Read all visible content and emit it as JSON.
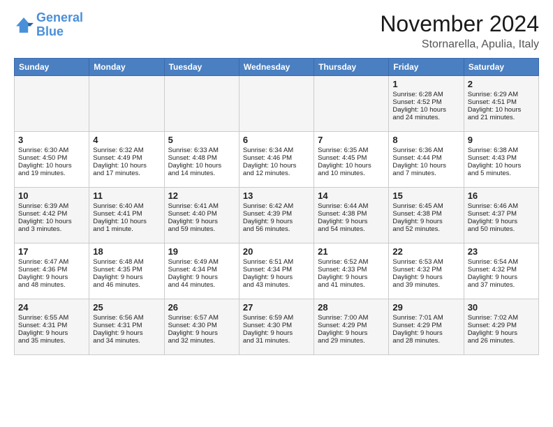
{
  "header": {
    "logo_line1": "General",
    "logo_line2": "Blue",
    "title": "November 2024",
    "subtitle": "Stornarella, Apulia, Italy"
  },
  "weekdays": [
    "Sunday",
    "Monday",
    "Tuesday",
    "Wednesday",
    "Thursday",
    "Friday",
    "Saturday"
  ],
  "weeks": [
    [
      {
        "day": "",
        "info": ""
      },
      {
        "day": "",
        "info": ""
      },
      {
        "day": "",
        "info": ""
      },
      {
        "day": "",
        "info": ""
      },
      {
        "day": "",
        "info": ""
      },
      {
        "day": "1",
        "info": "Sunrise: 6:28 AM\nSunset: 4:52 PM\nDaylight: 10 hours\nand 24 minutes."
      },
      {
        "day": "2",
        "info": "Sunrise: 6:29 AM\nSunset: 4:51 PM\nDaylight: 10 hours\nand 21 minutes."
      }
    ],
    [
      {
        "day": "3",
        "info": "Sunrise: 6:30 AM\nSunset: 4:50 PM\nDaylight: 10 hours\nand 19 minutes."
      },
      {
        "day": "4",
        "info": "Sunrise: 6:32 AM\nSunset: 4:49 PM\nDaylight: 10 hours\nand 17 minutes."
      },
      {
        "day": "5",
        "info": "Sunrise: 6:33 AM\nSunset: 4:48 PM\nDaylight: 10 hours\nand 14 minutes."
      },
      {
        "day": "6",
        "info": "Sunrise: 6:34 AM\nSunset: 4:46 PM\nDaylight: 10 hours\nand 12 minutes."
      },
      {
        "day": "7",
        "info": "Sunrise: 6:35 AM\nSunset: 4:45 PM\nDaylight: 10 hours\nand 10 minutes."
      },
      {
        "day": "8",
        "info": "Sunrise: 6:36 AM\nSunset: 4:44 PM\nDaylight: 10 hours\nand 7 minutes."
      },
      {
        "day": "9",
        "info": "Sunrise: 6:38 AM\nSunset: 4:43 PM\nDaylight: 10 hours\nand 5 minutes."
      }
    ],
    [
      {
        "day": "10",
        "info": "Sunrise: 6:39 AM\nSunset: 4:42 PM\nDaylight: 10 hours\nand 3 minutes."
      },
      {
        "day": "11",
        "info": "Sunrise: 6:40 AM\nSunset: 4:41 PM\nDaylight: 10 hours\nand 1 minute."
      },
      {
        "day": "12",
        "info": "Sunrise: 6:41 AM\nSunset: 4:40 PM\nDaylight: 9 hours\nand 59 minutes."
      },
      {
        "day": "13",
        "info": "Sunrise: 6:42 AM\nSunset: 4:39 PM\nDaylight: 9 hours\nand 56 minutes."
      },
      {
        "day": "14",
        "info": "Sunrise: 6:44 AM\nSunset: 4:38 PM\nDaylight: 9 hours\nand 54 minutes."
      },
      {
        "day": "15",
        "info": "Sunrise: 6:45 AM\nSunset: 4:38 PM\nDaylight: 9 hours\nand 52 minutes."
      },
      {
        "day": "16",
        "info": "Sunrise: 6:46 AM\nSunset: 4:37 PM\nDaylight: 9 hours\nand 50 minutes."
      }
    ],
    [
      {
        "day": "17",
        "info": "Sunrise: 6:47 AM\nSunset: 4:36 PM\nDaylight: 9 hours\nand 48 minutes."
      },
      {
        "day": "18",
        "info": "Sunrise: 6:48 AM\nSunset: 4:35 PM\nDaylight: 9 hours\nand 46 minutes."
      },
      {
        "day": "19",
        "info": "Sunrise: 6:49 AM\nSunset: 4:34 PM\nDaylight: 9 hours\nand 44 minutes."
      },
      {
        "day": "20",
        "info": "Sunrise: 6:51 AM\nSunset: 4:34 PM\nDaylight: 9 hours\nand 43 minutes."
      },
      {
        "day": "21",
        "info": "Sunrise: 6:52 AM\nSunset: 4:33 PM\nDaylight: 9 hours\nand 41 minutes."
      },
      {
        "day": "22",
        "info": "Sunrise: 6:53 AM\nSunset: 4:32 PM\nDaylight: 9 hours\nand 39 minutes."
      },
      {
        "day": "23",
        "info": "Sunrise: 6:54 AM\nSunset: 4:32 PM\nDaylight: 9 hours\nand 37 minutes."
      }
    ],
    [
      {
        "day": "24",
        "info": "Sunrise: 6:55 AM\nSunset: 4:31 PM\nDaylight: 9 hours\nand 35 minutes."
      },
      {
        "day": "25",
        "info": "Sunrise: 6:56 AM\nSunset: 4:31 PM\nDaylight: 9 hours\nand 34 minutes."
      },
      {
        "day": "26",
        "info": "Sunrise: 6:57 AM\nSunset: 4:30 PM\nDaylight: 9 hours\nand 32 minutes."
      },
      {
        "day": "27",
        "info": "Sunrise: 6:59 AM\nSunset: 4:30 PM\nDaylight: 9 hours\nand 31 minutes."
      },
      {
        "day": "28",
        "info": "Sunrise: 7:00 AM\nSunset: 4:29 PM\nDaylight: 9 hours\nand 29 minutes."
      },
      {
        "day": "29",
        "info": "Sunrise: 7:01 AM\nSunset: 4:29 PM\nDaylight: 9 hours\nand 28 minutes."
      },
      {
        "day": "30",
        "info": "Sunrise: 7:02 AM\nSunset: 4:29 PM\nDaylight: 9 hours\nand 26 minutes."
      }
    ]
  ]
}
